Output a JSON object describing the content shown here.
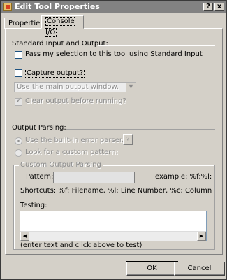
{
  "window": {
    "title": "Edit Tool Properties",
    "help_label": "?",
    "close_label": "x"
  },
  "tabs": [
    {
      "label": "Properties",
      "active": false
    },
    {
      "label": "Console I/O",
      "active": true
    }
  ],
  "standard_io": {
    "heading": "Standard Input and Output:",
    "pass_selection_label": "Pass my selection to this tool using Standard Input",
    "pass_selection_checked": false,
    "capture_output_label": "Capture output?",
    "capture_output_checked": false,
    "output_window_value": "Use the main output window.",
    "clear_output_label": "Clear output before running?",
    "clear_output_checked": true
  },
  "output_parsing": {
    "heading": "Output Parsing:",
    "builtin_parser_label": "Use the built-in error parser.",
    "builtin_parser_selected": true,
    "custom_pattern_label": "Look for a custom pattern:",
    "custom_pattern_selected": false,
    "help_button_label": "?"
  },
  "custom_output": {
    "group_title": "Custom Output Parsing",
    "pattern_label": "Pattern:",
    "pattern_value": "",
    "example_text": "example: %f:%l:",
    "shortcuts_text": "Shortcuts:  %f: Filename, %l: Line Number, %c: Column",
    "testing_label": "Testing:",
    "testing_value": "",
    "testing_hint": "(enter text and click above to test)"
  },
  "buttons": {
    "ok": "OK",
    "cancel": "Cancel"
  }
}
